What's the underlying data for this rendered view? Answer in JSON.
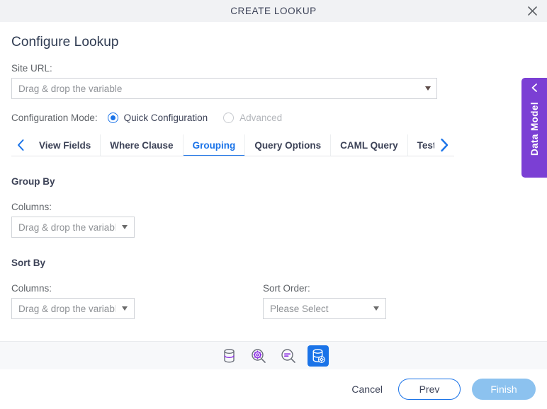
{
  "window": {
    "title": "CREATE LOOKUP",
    "close_icon": "close-icon"
  },
  "page": {
    "heading": "Configure Lookup"
  },
  "site_url": {
    "label": "Site URL:",
    "value": "Drag & drop the variable"
  },
  "config_mode": {
    "label": "Configuration Mode:",
    "options": [
      {
        "label": "Quick Configuration",
        "selected": true,
        "disabled": false
      },
      {
        "label": "Advanced",
        "selected": false,
        "disabled": true
      }
    ]
  },
  "tabs": {
    "prev_arrow_icon": "chevron-left-icon",
    "next_arrow_icon": "chevron-right-icon",
    "items": [
      {
        "label": "View Fields",
        "active": false
      },
      {
        "label": "Where Clause",
        "active": false
      },
      {
        "label": "Grouping",
        "active": true
      },
      {
        "label": "Query Options",
        "active": false
      },
      {
        "label": "CAML Query",
        "active": false
      },
      {
        "label": "Test Que",
        "active": false
      }
    ]
  },
  "group_by": {
    "title": "Group By",
    "columns_label": "Columns:",
    "columns_value": "Drag & drop the variabl"
  },
  "sort_by": {
    "title": "Sort By",
    "columns_label": "Columns:",
    "columns_value": "Drag & drop the variabl",
    "sort_order_label": "Sort Order:",
    "sort_order_value": "Please Select"
  },
  "data_model": {
    "label": "Data Model",
    "chevron_icon": "chevron-left-icon",
    "color": "#7b3fd4"
  },
  "toolbar": {
    "icons": [
      {
        "name": "database-icon",
        "active": false
      },
      {
        "name": "search-settings-icon",
        "active": false
      },
      {
        "name": "search-filter-icon",
        "active": false
      },
      {
        "name": "database-settings-icon",
        "active": true
      }
    ]
  },
  "footer": {
    "cancel_label": "Cancel",
    "prev_label": "Prev",
    "finish_label": "Finish"
  },
  "colors": {
    "accent_blue": "#1a73e8",
    "purple": "#7b3fd4",
    "finish_blue": "#8cc2ef",
    "titlebar_bg": "#f1f2f4"
  }
}
